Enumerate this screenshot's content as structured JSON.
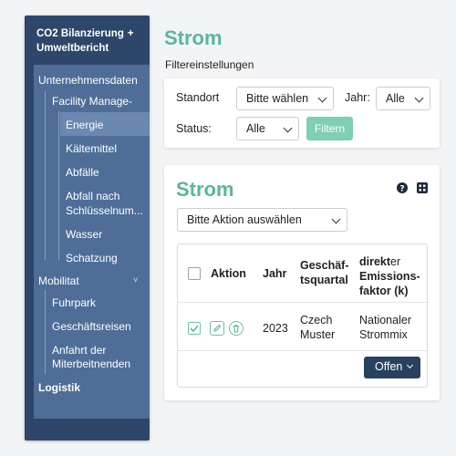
{
  "sidebar": {
    "title_line1": "CO2 Bilanzierung",
    "title_plus": "+",
    "title_line2": "Umweltbericht",
    "items": [
      {
        "label": "Unternehmensdaten"
      },
      {
        "label": "Facility Manage-"
      },
      {
        "label": "Energie"
      },
      {
        "label": "Kältemittel"
      },
      {
        "label": "Abfälle"
      },
      {
        "label": "Abfall nach"
      },
      {
        "label": "Schlüsselnum..."
      },
      {
        "label": "Wasser"
      },
      {
        "label": "Schatzung"
      },
      {
        "label": "Mobilitat"
      },
      {
        "label": "Fuhrpark"
      },
      {
        "label": "Geschäftsreisen"
      },
      {
        "label": "Anfahrt der"
      },
      {
        "label": "Miterbeitnenden"
      },
      {
        "label": "Logistik"
      }
    ],
    "active_item": "Energie",
    "expand_chevron": "˅"
  },
  "page": {
    "title": "Strom",
    "filter_heading": "Filtereinstellungen"
  },
  "filters": {
    "standort_label": "Standort",
    "standort_value": "Bitte wählen",
    "jahr_label": "Jahr:",
    "jahr_value": "Alle",
    "status_label": "Status:",
    "status_value": "Alle",
    "filter_button": "Filtern"
  },
  "table_card": {
    "title": "Strom",
    "action_select": "Bitte Aktion auswählen",
    "columns": {
      "aktion": "Aktion",
      "jahr": "Jahr",
      "quartal_l1": "Geschäf-",
      "quartal_l2": "tsquartal",
      "faktor_l1_bold": "direkt",
      "faktor_l1_rest": "er",
      "faktor_l2": "Emissions-",
      "faktor_l3": "faktor (k)"
    },
    "rows": [
      {
        "jahr": "2023",
        "quartal_l1": "Czech",
        "quartal_l2": "Muster",
        "faktor_l1": "Nationaler",
        "faktor_l2": "Strommix",
        "checked": true
      }
    ],
    "offen_button": "Offen"
  },
  "colors": {
    "accent_green": "#5cb59c",
    "sidebar_dark": "#2d4669",
    "sidebar_panel": "#4e6e97",
    "button_dark": "#28415f"
  }
}
